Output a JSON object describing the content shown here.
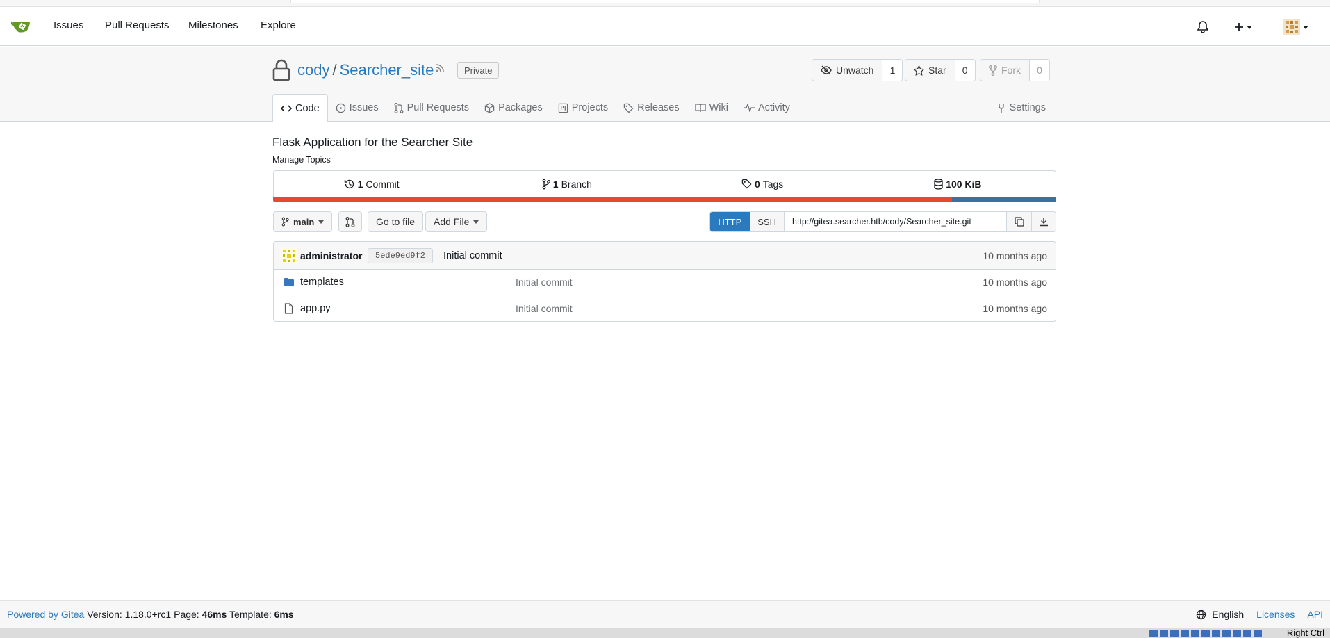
{
  "nav": {
    "items": [
      "Issues",
      "Pull Requests",
      "Milestones",
      "Explore"
    ]
  },
  "repo": {
    "owner": "cody",
    "separator": "/",
    "name": "Searcher_site",
    "visibility": "Private",
    "watch": {
      "label": "Unwatch",
      "count": "1"
    },
    "star": {
      "label": "Star",
      "count": "0"
    },
    "fork": {
      "label": "Fork",
      "count": "0"
    }
  },
  "tabs": {
    "code": "Code",
    "issues": "Issues",
    "pulls": "Pull Requests",
    "packages": "Packages",
    "projects": "Projects",
    "releases": "Releases",
    "wiki": "Wiki",
    "activity": "Activity",
    "settings": "Settings"
  },
  "description": "Flask Application for the Searcher Site",
  "topics_link": "Manage Topics",
  "stats": {
    "commits_count": "1",
    "commits_label": "Commit",
    "branches_count": "1",
    "branches_label": "Branch",
    "tags_count": "0",
    "tags_label": "Tags",
    "size": "100 KiB"
  },
  "language_bar": [
    {
      "color": "#e34c26",
      "percent": 86.7
    },
    {
      "color": "#3572a5",
      "percent": 13.3
    }
  ],
  "toolbar": {
    "branch": "main",
    "go_to_file": "Go to file",
    "add_file": "Add File",
    "http": "HTTP",
    "ssh": "SSH",
    "clone_url": "http://gitea.searcher.htb/cody/Searcher_site.git"
  },
  "latest_commit": {
    "author": "administrator",
    "sha": "5ede9ed9f2",
    "message": "Initial commit",
    "age": "10 months ago"
  },
  "files": [
    {
      "name": "templates",
      "type": "folder",
      "message": "Initial commit",
      "age": "10 months ago"
    },
    {
      "name": "app.py",
      "type": "file",
      "message": "Initial commit",
      "age": "10 months ago"
    }
  ],
  "footer": {
    "powered_by": "Powered by Gitea",
    "version": "Version: 1.18.0+rc1",
    "page_label": "Page:",
    "page_time": "46ms",
    "template_label": "Template:",
    "template_time": "6ms",
    "language": "English",
    "licenses": "Licenses",
    "api": "API"
  },
  "taskbar": {
    "right_ctrl": "Right Ctrl"
  },
  "colors": {
    "accent": "#2a7ac0",
    "gitea_green": "#609926"
  }
}
